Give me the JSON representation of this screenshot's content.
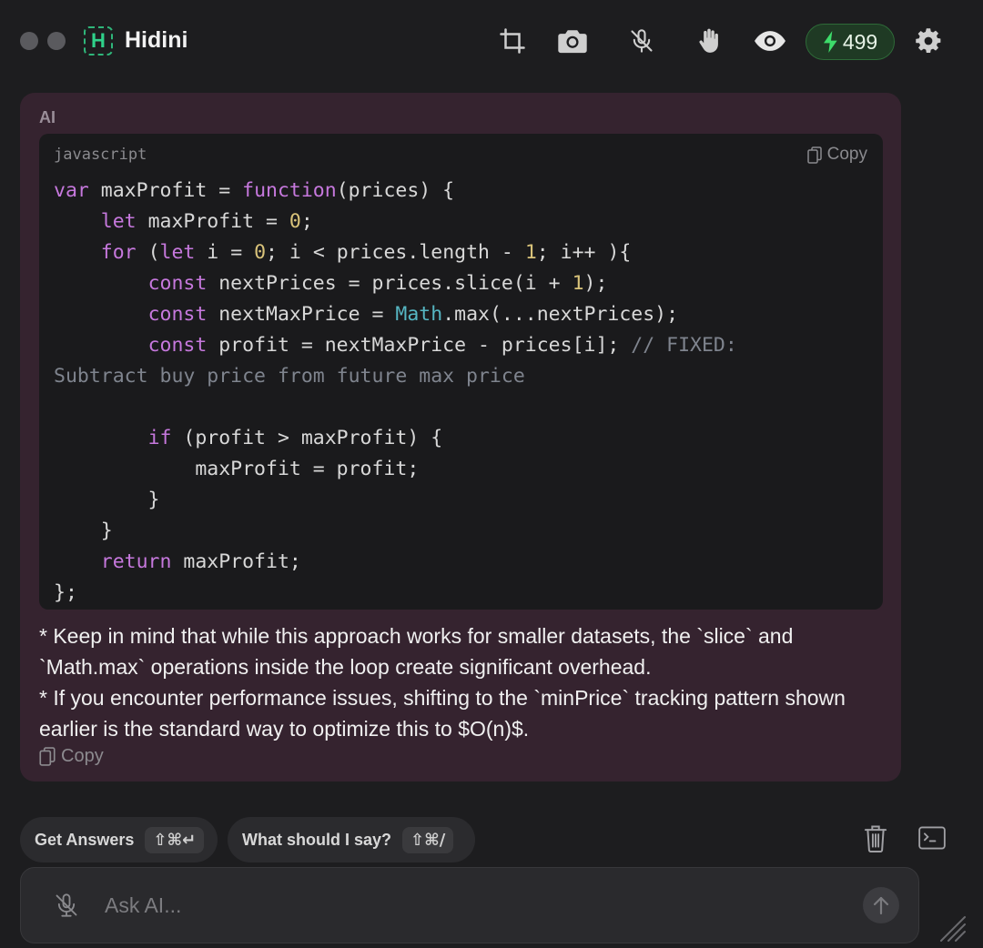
{
  "app": {
    "title": "Hidini",
    "logo_letter": "H"
  },
  "toolbar": {
    "credits": "499"
  },
  "ai_message": {
    "label": "AI",
    "code": {
      "language": "javascript",
      "copy_label": "Copy",
      "lines": [
        [
          {
            "t": "var",
            "c": "kw"
          },
          {
            "t": " maxProfit = "
          },
          {
            "t": "function",
            "c": "kw"
          },
          {
            "t": "(prices) {"
          }
        ],
        [
          {
            "t": "    "
          },
          {
            "t": "let",
            "c": "kw"
          },
          {
            "t": " maxProfit = "
          },
          {
            "t": "0",
            "c": "num"
          },
          {
            "t": ";"
          }
        ],
        [
          {
            "t": "    "
          },
          {
            "t": "for",
            "c": "kw"
          },
          {
            "t": " ("
          },
          {
            "t": "let",
            "c": "kw"
          },
          {
            "t": " i = "
          },
          {
            "t": "0",
            "c": "num"
          },
          {
            "t": "; i < prices.length - "
          },
          {
            "t": "1",
            "c": "num"
          },
          {
            "t": "; i++ ){"
          }
        ],
        [
          {
            "t": "        "
          },
          {
            "t": "const",
            "c": "kw"
          },
          {
            "t": " nextPrices = prices.slice(i + "
          },
          {
            "t": "1",
            "c": "num"
          },
          {
            "t": ");"
          }
        ],
        [
          {
            "t": "        "
          },
          {
            "t": "const",
            "c": "kw"
          },
          {
            "t": " nextMaxPrice = "
          },
          {
            "t": "Math",
            "c": "obj"
          },
          {
            "t": ".max(...nextPrices);"
          }
        ],
        [
          {
            "t": "        "
          },
          {
            "t": "const",
            "c": "kw"
          },
          {
            "t": " profit = nextMaxPrice - prices[i]; "
          },
          {
            "t": "// FIXED:",
            "c": "cm"
          }
        ],
        [
          {
            "t": "Subtract buy price from future max price",
            "c": "cm"
          }
        ],
        [],
        [
          {
            "t": "        "
          },
          {
            "t": "if",
            "c": "kw"
          },
          {
            "t": " (profit > maxProfit) {"
          }
        ],
        [
          {
            "t": "            maxProfit = profit;"
          }
        ],
        [
          {
            "t": "        }"
          }
        ],
        [
          {
            "t": "    }"
          }
        ],
        [
          {
            "t": "    "
          },
          {
            "t": "return",
            "c": "kw"
          },
          {
            "t": " maxProfit;"
          }
        ],
        [
          {
            "t": "};"
          }
        ]
      ]
    },
    "text": "* Keep in mind that while this approach works for smaller datasets, the `slice` and `Math.max` operations inside the loop create significant overhead.\n* If you encounter performance issues, shifting to the `minPrice` tracking pattern shown earlier is the standard way to optimize this to $O(n)$.",
    "copy_label": "Copy"
  },
  "actions": {
    "get_answers": {
      "label": "Get Answers",
      "shortcut": "⇧⌘↵"
    },
    "what_to_say": {
      "label": "What should I say?",
      "shortcut": "⇧⌘/"
    }
  },
  "input": {
    "placeholder": "Ask AI..."
  },
  "colors": {
    "accent_green": "#2fd18a",
    "card_bg": "#35232f",
    "code_bg": "#1a1a1c"
  }
}
